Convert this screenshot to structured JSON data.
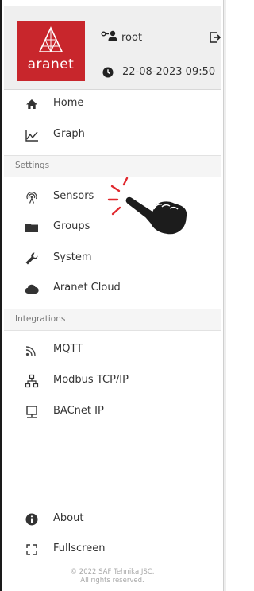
{
  "brand": {
    "logo_text": "aranet",
    "color": "#c8262c"
  },
  "header": {
    "user": "root",
    "datetime": "22-08-2023 09:50",
    "icons": {
      "user": "user-key-icon",
      "logout": "logout-icon",
      "clock": "clock-icon"
    }
  },
  "nav": {
    "home": {
      "label": "Home",
      "icon": "home-icon"
    },
    "graph": {
      "label": "Graph",
      "icon": "graph-icon"
    }
  },
  "settings": {
    "title": "Settings",
    "items": [
      {
        "label": "Sensors",
        "icon": "sensor-icon"
      },
      {
        "label": "Groups",
        "icon": "folder-icon"
      },
      {
        "label": "System",
        "icon": "wrench-icon"
      },
      {
        "label": "Aranet Cloud",
        "icon": "cloud-icon"
      }
    ]
  },
  "integrations": {
    "title": "Integrations",
    "items": [
      {
        "label": "MQTT",
        "icon": "rss-icon"
      },
      {
        "label": "Modbus TCP/IP",
        "icon": "network-icon"
      },
      {
        "label": "BACnet IP",
        "icon": "monitor-icon"
      }
    ]
  },
  "footer": {
    "about": {
      "label": "About",
      "icon": "info-icon"
    },
    "fullscreen": {
      "label": "Fullscreen",
      "icon": "fullscreen-icon"
    },
    "copyright_line1": "© 2022 SAF Tehnika JSC.",
    "copyright_line2": "All rights reserved."
  }
}
